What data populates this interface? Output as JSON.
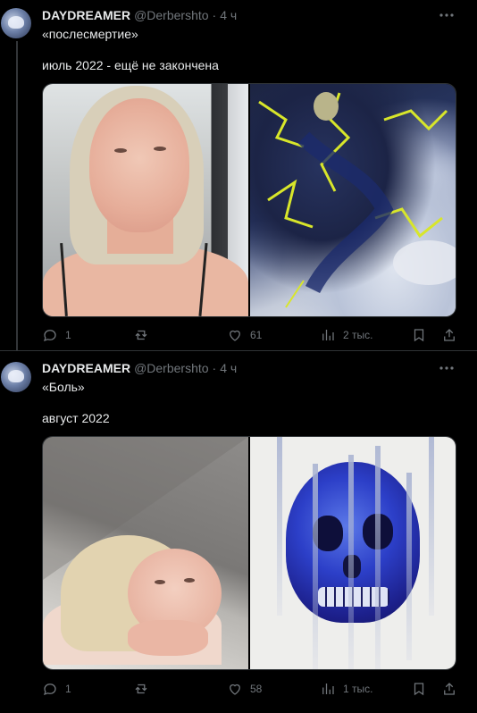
{
  "tweets": [
    {
      "author": {
        "name": "DAYDREAMER",
        "handle": "@Derbershto",
        "time": "4 ч"
      },
      "line1": "«послесмертие»",
      "line2": "июль 2022 - ещё не закончена",
      "stats": {
        "replies": "1",
        "reposts": "",
        "likes": "61",
        "views": "2 тыс."
      }
    },
    {
      "author": {
        "name": "DAYDREAMER",
        "handle": "@Derbershto",
        "time": "4 ч"
      },
      "line1": "«Боль»",
      "line2": "август 2022",
      "stats": {
        "replies": "1",
        "reposts": "",
        "likes": "58",
        "views": "1 тыс."
      }
    }
  ],
  "icons": {
    "more": "more-horizontal-icon",
    "reply": "reply-icon",
    "repost": "repost-icon",
    "like": "heart-icon",
    "views": "views-icon",
    "bookmark": "bookmark-icon",
    "share": "share-icon"
  },
  "colors": {
    "background": "#000000",
    "text": "#e7e9ea",
    "muted": "#71767b",
    "border": "#2f3336"
  }
}
